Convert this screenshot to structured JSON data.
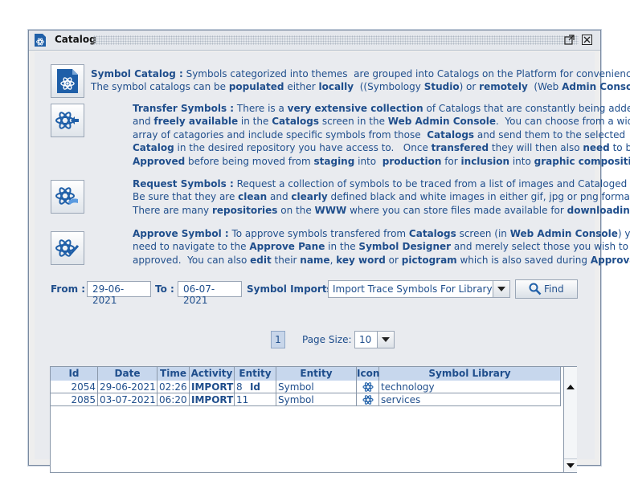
{
  "window": {
    "title": "Catalog"
  },
  "sections": [
    {
      "heading": "Symbol Catalog :",
      "lines": [
        [
          [
            "Symbol Catalog :",
            true
          ],
          [
            " Symbols categorized into themes  are grouped into Catalogs on the Platform for convenience",
            false
          ]
        ],
        [
          [
            "The symbol catalogs can be ",
            false
          ],
          [
            "populated",
            true
          ],
          [
            " either ",
            false
          ],
          [
            "locally",
            true
          ],
          [
            "  ((Symbology ",
            false
          ],
          [
            "Studio",
            true
          ],
          [
            ") or ",
            false
          ],
          [
            "remotely",
            true
          ],
          [
            "  (Web ",
            false
          ],
          [
            "Admin Console",
            true
          ],
          [
            ")",
            false
          ]
        ]
      ]
    },
    {
      "heading": "Transfer Symbols :",
      "lines": [
        [
          [
            "Transfer Symbols :",
            true
          ],
          [
            " There is a ",
            false
          ],
          [
            "very extensive collection",
            true
          ],
          [
            " of Catalogs that are constantly being added",
            false
          ]
        ],
        [
          [
            "and ",
            false
          ],
          [
            "freely available",
            true
          ],
          [
            " in the ",
            false
          ],
          [
            "Catalogs",
            true
          ],
          [
            " screen in the ",
            false
          ],
          [
            "Web Admin Console",
            true
          ],
          [
            ".  You can choose from a wide",
            false
          ]
        ],
        [
          [
            "array of catagories and include specific symbols from those  ",
            false
          ],
          [
            "Catalogs",
            true
          ],
          [
            " and send them to the selected",
            false
          ]
        ],
        [
          [
            "Catalog",
            true
          ],
          [
            " in the desired repository you have access to.   Once ",
            false
          ],
          [
            "transfered",
            true
          ],
          [
            " they will then also ",
            false
          ],
          [
            "need",
            true
          ],
          [
            " to be",
            false
          ]
        ],
        [
          [
            "Approved",
            true
          ],
          [
            " before being moved from ",
            false
          ],
          [
            "staging",
            true
          ],
          [
            " into  ",
            false
          ],
          [
            "production",
            true
          ],
          [
            " for ",
            false
          ],
          [
            "inclusion",
            true
          ],
          [
            " into ",
            false
          ],
          [
            "graphic compositions",
            true
          ],
          [
            ".",
            false
          ]
        ]
      ]
    },
    {
      "heading": "Request Symbols :",
      "lines": [
        [
          [
            "Request Symbols :",
            true
          ],
          [
            " Request a collection of symbols to be traced from a list of images and Cataloged",
            false
          ]
        ],
        [
          [
            "Be sure that they are ",
            false
          ],
          [
            "clean",
            true
          ],
          [
            " and ",
            false
          ],
          [
            "clearly",
            true
          ],
          [
            " defined black and white images in either gif, jpg or png format.",
            false
          ]
        ],
        [
          [
            "There are many ",
            false
          ],
          [
            "repositories",
            true
          ],
          [
            " on the ",
            false
          ],
          [
            "WWW",
            true
          ],
          [
            " where you can store files made available for ",
            false
          ],
          [
            "downloading",
            true
          ]
        ]
      ]
    },
    {
      "heading": "Approve Symbol :",
      "lines": [
        [
          [
            "Approve Symbol :",
            true
          ],
          [
            " To approve symbols transfered from ",
            false
          ],
          [
            "Catalogs",
            true
          ],
          [
            " screen (in ",
            false
          ],
          [
            "Web Admin Console",
            true
          ],
          [
            ") you",
            false
          ]
        ],
        [
          [
            "need to navigate to the ",
            false
          ],
          [
            "Approve Pane",
            true
          ],
          [
            " in the ",
            false
          ],
          [
            "Symbol Designer",
            true
          ],
          [
            " and merely select those you wish to be",
            false
          ]
        ],
        [
          [
            "approved.  You can also ",
            false
          ],
          [
            "edit",
            true
          ],
          [
            " their ",
            false
          ],
          [
            "name",
            true
          ],
          [
            ", ",
            false
          ],
          [
            "key word",
            true
          ],
          [
            " or ",
            false
          ],
          [
            "pictogram",
            true
          ],
          [
            " which is also saved during ",
            false
          ],
          [
            "Approval",
            true
          ]
        ]
      ]
    }
  ],
  "filters": {
    "from_label": "From :",
    "from_value": "29-06-2021",
    "to_label": "To :",
    "to_value": "06-07-2021",
    "imports_label": "Symbol Imports :",
    "imports_value": "Import Trace Symbols For Library",
    "find_label": "Find"
  },
  "paging": {
    "page": "1",
    "page_size_label": "Page Size:",
    "page_size": "10"
  },
  "table": {
    "columns": [
      "Id",
      "Date",
      "Time",
      "Activity",
      "Entity Id",
      "Entity",
      "Icon",
      "Symbol Library"
    ],
    "rows": [
      {
        "id": "2054",
        "date": "29-06-2021",
        "time": "02:26",
        "activity": "IMPORT",
        "entity_id": "8",
        "entity": "Symbol",
        "icon": "atom-icon",
        "library": "technology"
      },
      {
        "id": "2085",
        "date": "03-07-2021",
        "time": "06:20",
        "activity": "IMPORT",
        "entity_id": "11",
        "entity": "Symbol",
        "icon": "atom-icon",
        "library": "services"
      }
    ]
  },
  "colors": {
    "text": "#1f4e8c",
    "header": "#c7d7ed",
    "accent": "#1f5fa8"
  }
}
